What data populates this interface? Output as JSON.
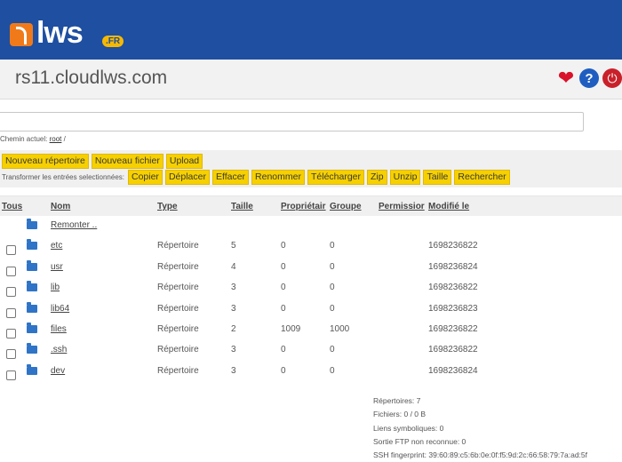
{
  "brand": {
    "logo_text": "lws",
    "logo_badge": ".FR",
    "colors": {
      "header_bg": "#1e4fa0",
      "button_bg": "#f6d000",
      "accent": "#f07a1a"
    }
  },
  "host": {
    "name": "rs11.cloudlws.com"
  },
  "icons": {
    "heart": "heart-icon",
    "help": "help-icon",
    "power": "power-icon",
    "folder": "folder-icon"
  },
  "command": {
    "value": ""
  },
  "path": {
    "label": "Chemin actuel:",
    "root_link": "root",
    "suffix": "/"
  },
  "actions": {
    "row1": [
      "Nouveau répertoire",
      "Nouveau fichier",
      "Upload"
    ],
    "transform_label": "Transformer les entrées selectionnées:",
    "row2": [
      "Copier",
      "Déplacer",
      "Effacer",
      "Renommer",
      "Télécharger",
      "Zip",
      "Unzip",
      "Taille",
      "Rechercher"
    ]
  },
  "columns": {
    "all": "Tous",
    "name": "Nom",
    "type": "Type",
    "size": "Taille",
    "owner": "Propriétair",
    "group": "Groupe",
    "perm": "Permissior",
    "mtime": "Modifié le"
  },
  "parent": {
    "label": "Remonter .."
  },
  "rows": [
    {
      "name": "etc",
      "type": "Répertoire",
      "size": "5",
      "owner": "0",
      "group": "0",
      "mtime": "1698236822"
    },
    {
      "name": "usr",
      "type": "Répertoire",
      "size": "4",
      "owner": "0",
      "group": "0",
      "mtime": "1698236824"
    },
    {
      "name": "lib",
      "type": "Répertoire",
      "size": "3",
      "owner": "0",
      "group": "0",
      "mtime": "1698236822"
    },
    {
      "name": "lib64",
      "type": "Répertoire",
      "size": "3",
      "owner": "0",
      "group": "0",
      "mtime": "1698236823"
    },
    {
      "name": "files",
      "type": "Répertoire",
      "size": "2",
      "owner": "1009",
      "group": "1000",
      "mtime": "1698236822"
    },
    {
      "name": ".ssh",
      "type": "Répertoire",
      "size": "3",
      "owner": "0",
      "group": "0",
      "mtime": "1698236822"
    },
    {
      "name": "dev",
      "type": "Répertoire",
      "size": "3",
      "owner": "0",
      "group": "0",
      "mtime": "1698236824"
    }
  ],
  "stats": [
    "Répertoires: 7",
    "Fichiers: 0 / 0 B",
    "Liens symboliques: 0",
    "Sortie FTP non reconnue: 0",
    "SSH fingerprint: 39:60:89:c5:6b:0e:0f:f5:9d:2c:66:58:79:7a:ad:5f"
  ]
}
